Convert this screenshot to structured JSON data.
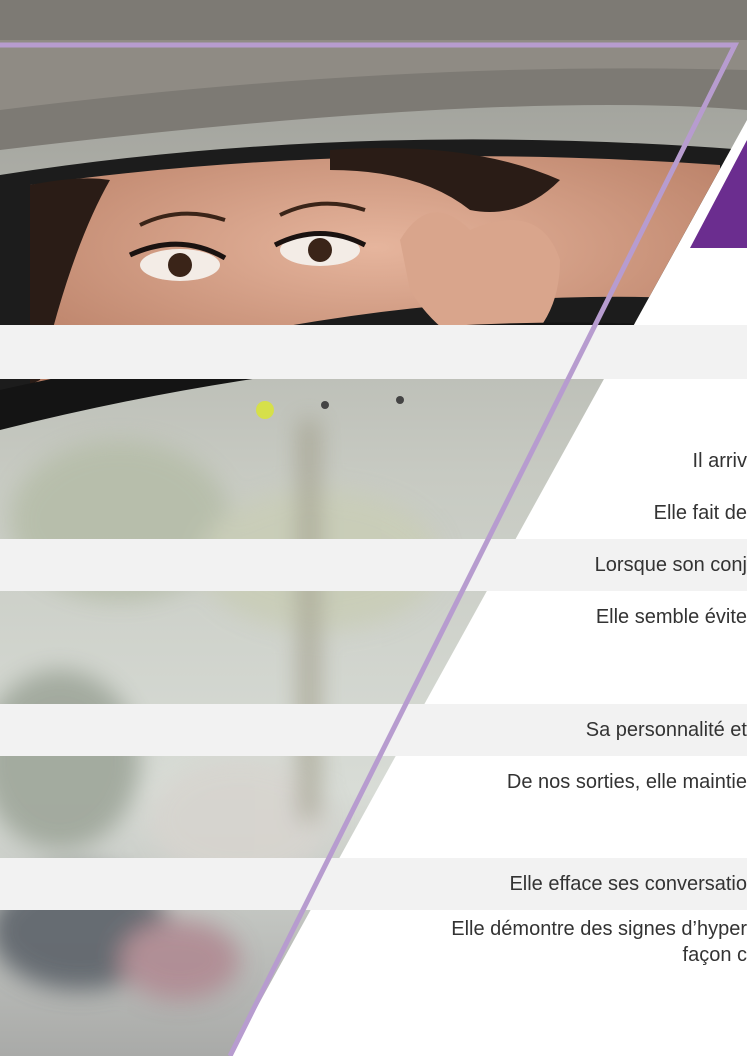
{
  "colors": {
    "accent": "#6b2d8f",
    "frame_line": "#b79ccf",
    "row_shade": "#f2f2f2",
    "text": "#333333"
  },
  "photo": {
    "description_icon": "rearview-mirror-photo"
  },
  "items": [
    {
      "text": "Il arriv",
      "shaded": true
    },
    {
      "text": "Elle fait de",
      "shaded": false
    },
    {
      "text": "Lorsque son conj",
      "shaded": true
    },
    {
      "text": "Elle semble évite",
      "shaded": false
    },
    {
      "text": "Sa personnalité et",
      "shaded": true
    },
    {
      "text": "De nos sorties, elle maintie",
      "shaded": false
    },
    {
      "text": "Elle efface ses conversatio",
      "shaded": true
    },
    {
      "text": "Elle démontre des signes d’hyper",
      "text2": "façon c",
      "shaded": false
    }
  ]
}
